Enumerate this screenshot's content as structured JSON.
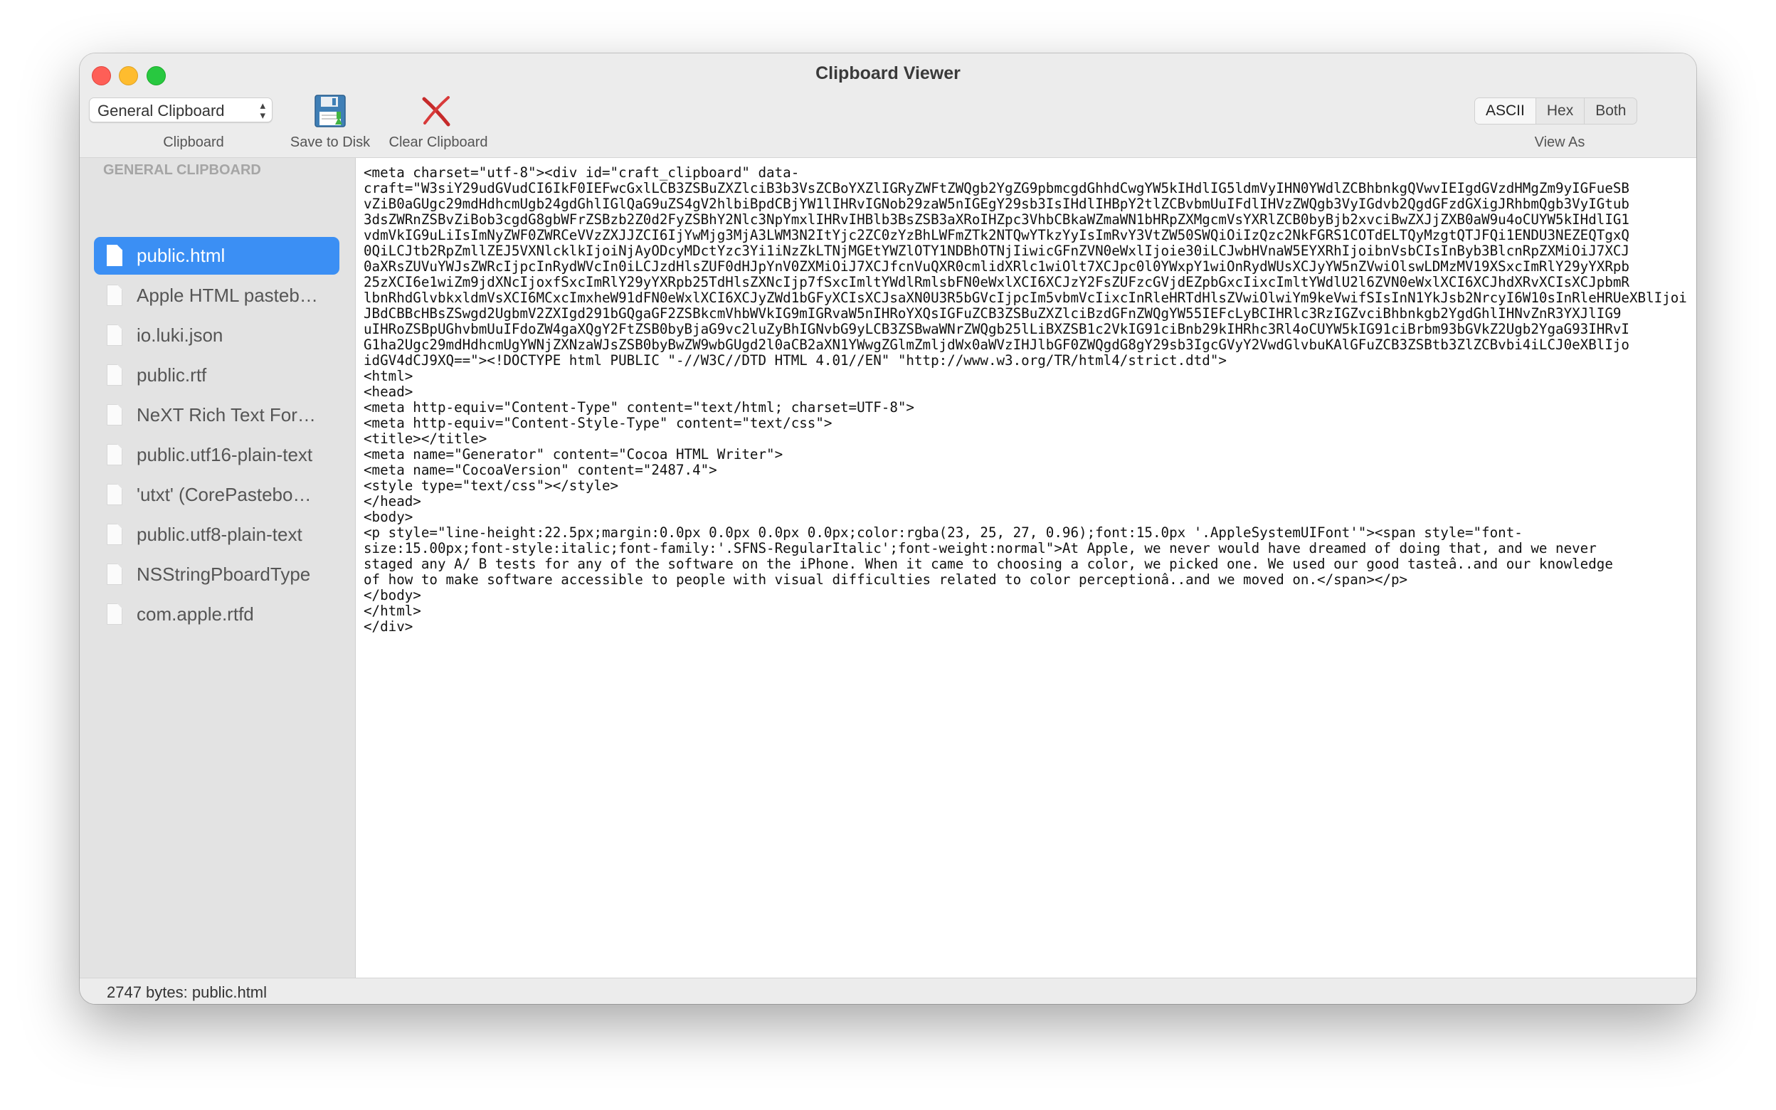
{
  "window": {
    "title": "Clipboard Viewer"
  },
  "toolbar": {
    "clipboard_popup": "General Clipboard",
    "clipboard_label": "Clipboard",
    "save_label": "Save to Disk",
    "clear_label": "Clear Clipboard",
    "view_as_label": "View As",
    "view_modes": [
      "ASCII",
      "Hex",
      "Both"
    ],
    "selected_view_mode": "ASCII"
  },
  "sidebar": {
    "header": "GENERAL CLIPBOARD",
    "items": [
      {
        "label": "public.html",
        "selected": true
      },
      {
        "label": "Apple HTML pasteb…",
        "selected": false
      },
      {
        "label": "io.luki.json",
        "selected": false
      },
      {
        "label": "public.rtf",
        "selected": false
      },
      {
        "label": "NeXT Rich Text For…",
        "selected": false
      },
      {
        "label": "public.utf16-plain-text",
        "selected": false
      },
      {
        "label": "'utxt' (CorePastebo…",
        "selected": false
      },
      {
        "label": "public.utf8-plain-text",
        "selected": false
      },
      {
        "label": "NSStringPboardType",
        "selected": false
      },
      {
        "label": "com.apple.rtfd",
        "selected": false
      }
    ]
  },
  "content": {
    "text": "<meta charset=\"utf-8\"><div id=\"craft_clipboard\" data-\ncraft=\"W3siY29udGVudCI6IkF0IEFwcGxlLCB3ZSBuZXZlciB3b3VsZCBoYXZlIGRyZWFtZWQgb2YgZG9pbmcgdGhhdCwgYW5kIHdlIG5ldmVyIHN0YWdlZCBhbnkgQVwvIEIgdGVzdHMgZm9yIGFueSB\nvZiB0aGUgc29mdHdhcmUgb24gdGhlIGlQaG9uZS4gV2hlbiBpdCBjYW1lIHRvIGNob29zaW5nIGEgY29sb3IsIHdlIHBpY2tlZCBvbmUuIFdlIHVzZWQgb3VyIGdvb2QgdGFzdGXigJRhbmQgb3VyIGtub\n3dsZWRnZSBvZiBob3cgdG8gbWFrZSBzb2Z0d2FyZSBhY2Nlc3NpYmxlIHRvIHBlb3BsZSB3aXRoIHZpc3VhbCBkaWZmaWN1bHRpZXMgcmVsYXRlZCB0byBjb2xvciBwZXJjZXB0aW9u4oCUYW5kIHdlIG1\nvdmVkIG9uLiIsImNyZWF0ZWRCeVVzZXJJZCI6IjYwMjg3MjA3LWM3N2ItYjc2ZC0zYzBhLWFmZTk2NTQwYTkzYyIsImRvY3VtZW50SWQiOiIzQzc2NkFGRS1COTdELTQyMzgtQTJFQi1ENDU3NEZEQTgxQ\n0QiLCJtb2RpZmllZEJ5VXNlcklkIjoiNjAyODcyMDctYzc3Yi1iNzZkLTNjMGEtYWZlOTY1NDBhOTNjIiwicGFnZVN0eWxlIjoie30iLCJwbHVnaW5EYXRhIjoibnVsbCIsInByb3BlcnRpZXMiOiJ7XCJ\n0aXRsZUVuYWJsZWRcIjpcInRydWVcIn0iLCJzdHlsZUF0dHJpYnV0ZXMiOiJ7XCJfcnVuQXR0cmlidXRlc1wiOlt7XCJpc0l0YWxpY1wiOnRydWUsXCJyYW5nZVwiOlswLDMzMV19XSxcImRlY29yYXRpb\n25zXCI6e1wiZm9jdXNcIjoxfSxcImRlY29yYXRpb25TdHlsZXNcIjp7fSxcImltYWdlRmlsbFN0eWxlXCI6XCJzY2FsZUFzcGVjdEZpbGxcIixcImltYWdlU2l6ZVN0eWxlXCI6XCJhdXRvXCIsXCJpbmR\nlbnRhdGlvbkxldmVsXCI6MCxcImxheW91dFN0eWxlXCI6XCJyZWd1bGFyXCIsXCJsaXN0U3R5bGVcIjpcIm5vbmVcIixcInRleHRTdHlsZVwiOlwiYm9keVwifSIsInN1YkJsb2NrcyI6W10sInRleHRUeXBlIjoi\nJBdCBBcHBsZSwgd2UgbmV2ZXIgd291bGQgaGF2ZSBkcmVhbWVkIG9mIGRvaW5nIHRoYXQsIGFuZCB3ZSBuZXZlciBzdGFnZWQgYW55IEFcLyBCIHRlc3RzIGZvciBhbnkgb2YgdGhlIHNvZnR3YXJlIG9\nuIHRoZSBpUGhvbmUuIFdoZW4gaXQgY2FtZSB0byBjaG9vc2luZyBhIGNvbG9yLCB3ZSBwaWNrZWQgb25lLiBXZSB1c2VkIG91ciBnb29kIHRhc3Rl4oCUYW5kIG91ciBrbm93bGVkZ2Ugb2YgaG93IHRvI\nG1ha2Ugc29mdHdhcmUgYWNjZXNzaWJsZSB0byBwZW9wbGUgd2l0aCB2aXN1YWwgZGlmZmljdWx0aWVzIHJlbGF0ZWQgdG8gY29sb3IgcGVyY2VwdGlvbuKAlGFuZCB3ZSBtb3ZlZCBvbi4iLCJ0eXBlIjo\nidGV4dCJ9XQ==\"><!DOCTYPE html PUBLIC \"-//W3C//DTD HTML 4.01//EN\" \"http://www.w3.org/TR/html4/strict.dtd\">\n<html>\n<head>\n<meta http-equiv=\"Content-Type\" content=\"text/html; charset=UTF-8\">\n<meta http-equiv=\"Content-Style-Type\" content=\"text/css\">\n<title></title>\n<meta name=\"Generator\" content=\"Cocoa HTML Writer\">\n<meta name=\"CocoaVersion\" content=\"2487.4\">\n<style type=\"text/css\"></style>\n</head>\n<body>\n<p style=\"line-height:22.5px;margin:0.0px 0.0px 0.0px 0.0px;color:rgba(23, 25, 27, 0.96);font:15.0px '.AppleSystemUIFont'\"><span style=\"font-\nsize:15.00px;font-style:italic;font-family:'.SFNS-RegularItalic';font-weight:normal\">At Apple, we never would have dreamed of doing that, and we never\nstaged any A/ B tests for any of the software on the iPhone. When it came to choosing a color, we picked one. We used our good tasteâ..and our knowledge\nof how to make software accessible to people with visual difficulties related to color perceptionâ..and we moved on.</span></p>\n</body>\n</html>\n</div>"
  },
  "status": {
    "text": "2747 bytes: public.html"
  }
}
